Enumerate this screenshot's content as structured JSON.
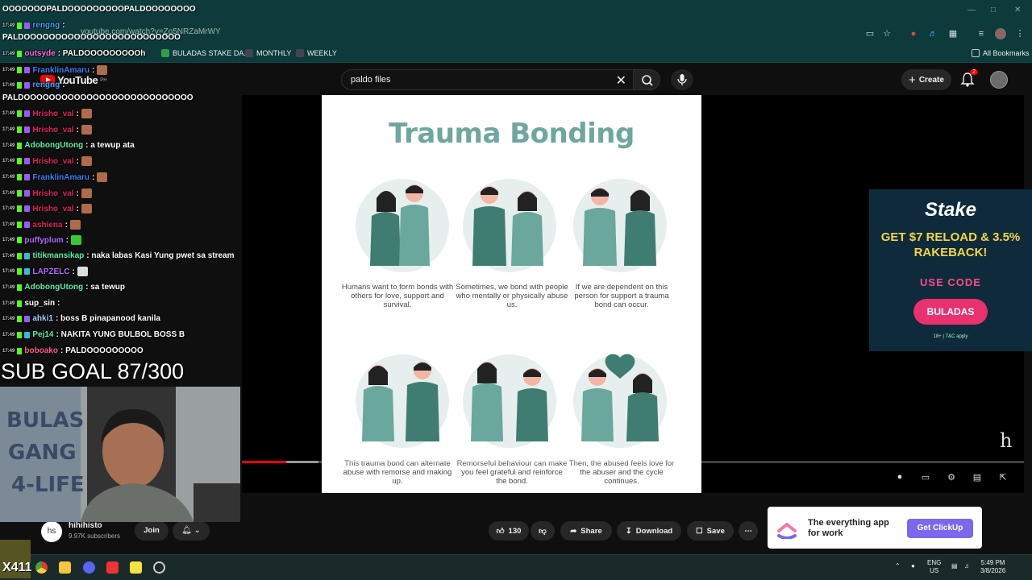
{
  "browser": {
    "url": "youtube.com/watch?v=Zo5NRZaMrWY",
    "bookmarks": [
      {
        "label": "BULADAS STAKE DA...",
        "color": "#2e9e4a"
      },
      {
        "label": "MONTHLY",
        "color": "#445"
      },
      {
        "label": "WEEKLY",
        "color": "#445"
      }
    ],
    "all_bookmarks": "All Bookmarks"
  },
  "youtube": {
    "logo": "YouTube",
    "logo_sup": "PH",
    "search_value": "paldo files",
    "create_label": "Create",
    "notif_count": "2"
  },
  "video": {
    "poster_title": "Trauma Bonding",
    "captions": [
      "Humans want to form bonds with others for love, support and survival.",
      "Sometimes, we bond with people who mentally or physically abuse us.",
      "If we are dependent on this person for support a trauma bond can occur.",
      "This trauma bond can alternate abuse with remorse and making up.",
      "Remorseful behaviour can make you feel grateful and reinforce the bond.",
      "Then, the abused feels love for the abuser and the cycle continues."
    ],
    "watermark": "h",
    "progress_fraction": 0.057
  },
  "ad_stake": {
    "brand": "Stake",
    "headline": "GET $7 RELOAD & 3.5% RAKEBACK!",
    "use_code": "USE CODE",
    "code": "BULADAS",
    "tnc": "18+ | T&C apply"
  },
  "channel": {
    "avatar_text": "hs",
    "name": "hihihisto",
    "subscribers": "9.97K subscribers",
    "join": "Join"
  },
  "actions": {
    "likes": "130",
    "share": "Share",
    "download": "Download",
    "save": "Save"
  },
  "ad_clickup": {
    "text": "The everything app for work",
    "button": "Get ClickUp"
  },
  "taskbar": {
    "lang": "ENG",
    "region": "US",
    "time": "5:49 PM",
    "date": "3/8/2026"
  },
  "chat": {
    "top_line": "OOOOOOOPALDOOOOOOOOOPALDOOOOOOOO",
    "lines": [
      {
        "ts": "17:49",
        "user": "rengng",
        "color": "#3ba7ff",
        "msg": ":"
      },
      {
        "ts": "",
        "user": "",
        "color": "#fff",
        "msg": "PALDOOOOOOOOOOOOOOOOOOOOOOOOO"
      },
      {
        "ts": "17:49",
        "user": "outsyde",
        "color": "#ff6ae0",
        "msg": ": PALDOOOOOOOOOh"
      },
      {
        "ts": "17:49",
        "user": "FranklinAmaru",
        "color": "#3b82f6",
        "msg": ":"
      },
      {
        "ts": "17:49",
        "user": "rengng",
        "color": "#3ba7ff",
        "msg": ":"
      },
      {
        "ts": "",
        "user": "",
        "color": "#fff",
        "msg": "PALDOOOOOOOOOOOOOOOOOOOOOOOOOOO"
      },
      {
        "ts": "17:49",
        "user": "Hrisho_val",
        "color": "#e0245e",
        "msg": ":"
      },
      {
        "ts": "17:49",
        "user": "Hrisho_val",
        "color": "#e0245e",
        "msg": ":"
      },
      {
        "ts": "17:49",
        "user": "AdobongUtong",
        "color": "#5cf2a8",
        "msg": ": a tewup ata"
      },
      {
        "ts": "17:49",
        "user": "Hrisho_val",
        "color": "#e0245e",
        "msg": ":"
      },
      {
        "ts": "17:49",
        "user": "FranklinAmaru",
        "color": "#3b82f6",
        "msg": ":"
      },
      {
        "ts": "17:49",
        "user": "Hrisho_val",
        "color": "#e0245e",
        "msg": ":"
      },
      {
        "ts": "17:49",
        "user": "Hrisho_val",
        "color": "#e0245e",
        "msg": ":"
      },
      {
        "ts": "17:49",
        "user": "ashiena",
        "color": "#e0245e",
        "msg": ":"
      },
      {
        "ts": "17:49",
        "user": "puffyplum",
        "color": "#b46bff",
        "msg": ":"
      },
      {
        "ts": "17:49",
        "user": "titikmansikap",
        "color": "#5cf2a8",
        "msg": ": naka labas Kasi Yung pwet sa stream"
      },
      {
        "ts": "17:49",
        "user": "LAPZELC",
        "color": "#b46bff",
        "msg": ":"
      },
      {
        "ts": "17:49",
        "user": "AdobongUtong",
        "color": "#5cf2a8",
        "msg": ": sa tewup"
      },
      {
        "ts": "17:49",
        "user": "sup_sin",
        "color": "#fff",
        "msg": ":"
      },
      {
        "ts": "17:49",
        "user": "ahki1",
        "color": "#9fd0ff",
        "msg": ": boss B pinapanood kanila"
      },
      {
        "ts": "17:49",
        "user": "Pej14",
        "color": "#5cf2a8",
        "msg": ": NAKITA YUNG BULBOL BOSS B"
      },
      {
        "ts": "17:49",
        "user": "boboako",
        "color": "#ff5c8a",
        "msg": ": PALDOOOOOOOOO"
      }
    ],
    "sub_goal": "SUB GOAL 87/300",
    "kick_count": "X411"
  },
  "colors": {
    "accent_red": "#ff0000",
    "teal": "#6ea79e",
    "browser_bg": "#0d3a3a"
  }
}
